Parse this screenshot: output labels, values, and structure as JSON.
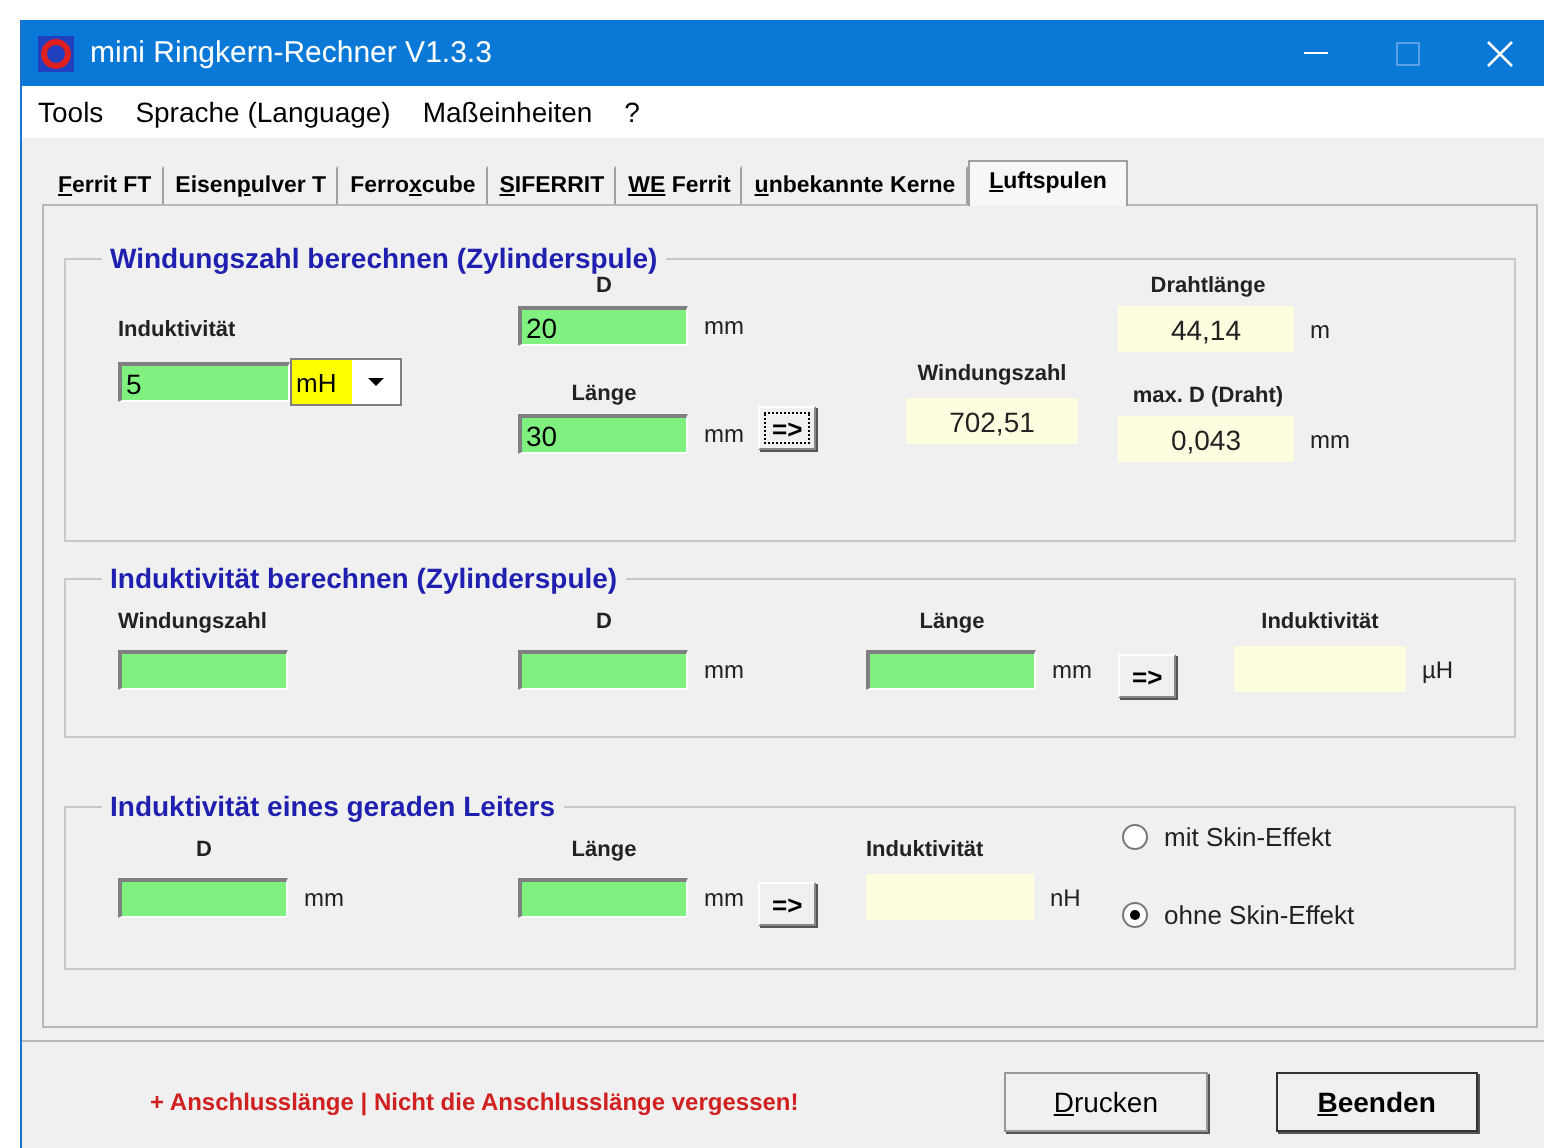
{
  "window": {
    "title": "mini Ringkern-Rechner V1.3.3"
  },
  "menu": [
    "Tools",
    "Sprache (Language)",
    "Maßeinheiten",
    "?"
  ],
  "tabs": [
    {
      "key": "F",
      "post": "errit FT",
      "selected": false
    },
    {
      "pre": "Eisen",
      "key": "p",
      "post": "ulver T",
      "selected": false
    },
    {
      "pre": "Ferro",
      "key": "x",
      "post": "cube",
      "selected": false
    },
    {
      "key": "S",
      "post": "IFERRIT",
      "selected": false
    },
    {
      "key": "WE",
      "post": " Ferrit",
      "selected": false
    },
    {
      "key": "u",
      "post": "nbekannte Kerne",
      "selected": false
    },
    {
      "key": "L",
      "post": "uftspulen",
      "selected": true
    }
  ],
  "coil_turns": {
    "title": "Windungszahl berechnen (Zylinderspule)",
    "inductance": {
      "label": "Induktivität",
      "value": "5",
      "unit": "mH"
    },
    "diameter": {
      "label": "D",
      "value": "20",
      "unit": "mm"
    },
    "length": {
      "label": "Länge",
      "value": "30",
      "unit": "mm"
    },
    "calc_button": {
      "label": "=>",
      "focused": true
    },
    "turns": {
      "label": "Windungszahl",
      "value": "702,51"
    },
    "wire_length": {
      "label": "Drahtlänge",
      "value": "44,14",
      "unit": "m"
    },
    "max_wire_d": {
      "label": "max. D (Draht)",
      "value": "0,043",
      "unit": "mm"
    }
  },
  "coil_inductance": {
    "title": "Induktivität berechnen (Zylinderspule)",
    "turns": {
      "label": "Windungszahl"
    },
    "diameter": {
      "label": "D",
      "unit": "mm"
    },
    "length": {
      "label": "Länge",
      "unit": "mm"
    },
    "calc_button": {
      "label": "=>",
      "focused": false
    },
    "inductance": {
      "label": "Induktivität",
      "unit": "µH"
    }
  },
  "wire_inductance": {
    "title": "Induktivität eines geraden Leiters",
    "diameter": {
      "label": "D",
      "unit": "mm"
    },
    "length": {
      "label": "Länge",
      "unit": "mm"
    },
    "calc_button": {
      "label": "=>",
      "focused": false
    },
    "inductance": {
      "label": "Induktivität",
      "unit": "nH"
    },
    "skin_options": [
      {
        "label": "mit Skin-Effekt",
        "selected": false
      },
      {
        "label": "ohne Skin-Effekt",
        "selected": true
      }
    ]
  },
  "footer": {
    "note": "+ Anschlusslänge | Nicht die Anschlusslänge vergessen!",
    "buttons": [
      {
        "key": "D",
        "post": "rucken",
        "default": false
      },
      {
        "key": "B",
        "post": "eenden",
        "default": true
      }
    ]
  }
}
